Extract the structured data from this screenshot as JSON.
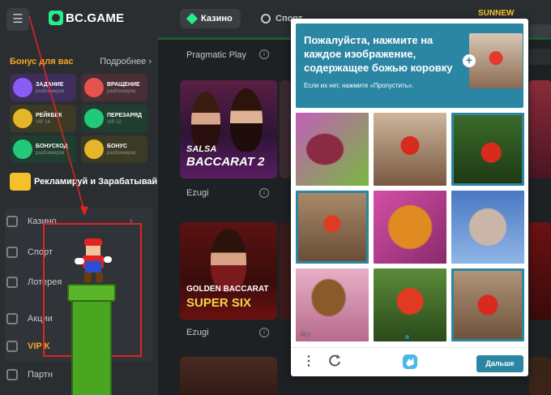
{
  "header": {
    "logo_text": "BC.GAME",
    "tab_casino": "Казино",
    "tab_sport": "Спорт",
    "user_name": "SUNNEW"
  },
  "sidebar": {
    "bonus_title": "Бонус для вас",
    "bonus_more": "Подробнее",
    "tiles": [
      {
        "title": "ЗАДАНИЕ",
        "sub": "разблокиров"
      },
      {
        "title": "ВРАЩЕНИЕ",
        "sub": "разблокиров"
      },
      {
        "title": "РЕЙКБЕК",
        "sub": "VIP 14"
      },
      {
        "title": "ПЕРЕЗАРЯД",
        "sub": "VIP 22"
      },
      {
        "title": "БОНУСКОД",
        "sub": "разблокиров"
      },
      {
        "title": "БОНУС",
        "sub": "разблокиров"
      }
    ],
    "promo": "Рекламируй и Зарабатывай",
    "nav": [
      "Казино",
      "Спорт",
      "Лотерея",
      "Акции",
      "VIP К",
      "Партн"
    ]
  },
  "main": {
    "provider_1": "Pragmatic Play",
    "provider_2": "Ezugi",
    "provider_3": "Ezugi",
    "card_1_line1": "SALSA",
    "card_1_line2": "BACCARAT 2",
    "card_2_line1": "GOLDEN BACCARAT",
    "card_2_line2": "SUPER SIX",
    "info_glyph": "i"
  },
  "captcha": {
    "title": "Пожалуйста, нажмите на каждое изображение, содержащее божью коровку",
    "subtitle": "Если их нет, нажмите «Пропустить».",
    "language": "RU",
    "next_button": "Дальше",
    "cells": [
      {
        "subject": "butterfly",
        "selected": false
      },
      {
        "subject": "ladybug",
        "selected": false
      },
      {
        "subject": "ladybug",
        "selected": true
      },
      {
        "subject": "ladybug",
        "selected": true
      },
      {
        "subject": "butterfly",
        "selected": false
      },
      {
        "subject": "moth",
        "selected": false
      },
      {
        "subject": "moth",
        "selected": false
      },
      {
        "subject": "ladybug",
        "selected": false
      },
      {
        "subject": "ladybug",
        "selected": true
      }
    ]
  },
  "colors": {
    "accent_green": "#24ee89",
    "captcha_blue": "#2b86a3",
    "annotation_red": "#e02424"
  }
}
